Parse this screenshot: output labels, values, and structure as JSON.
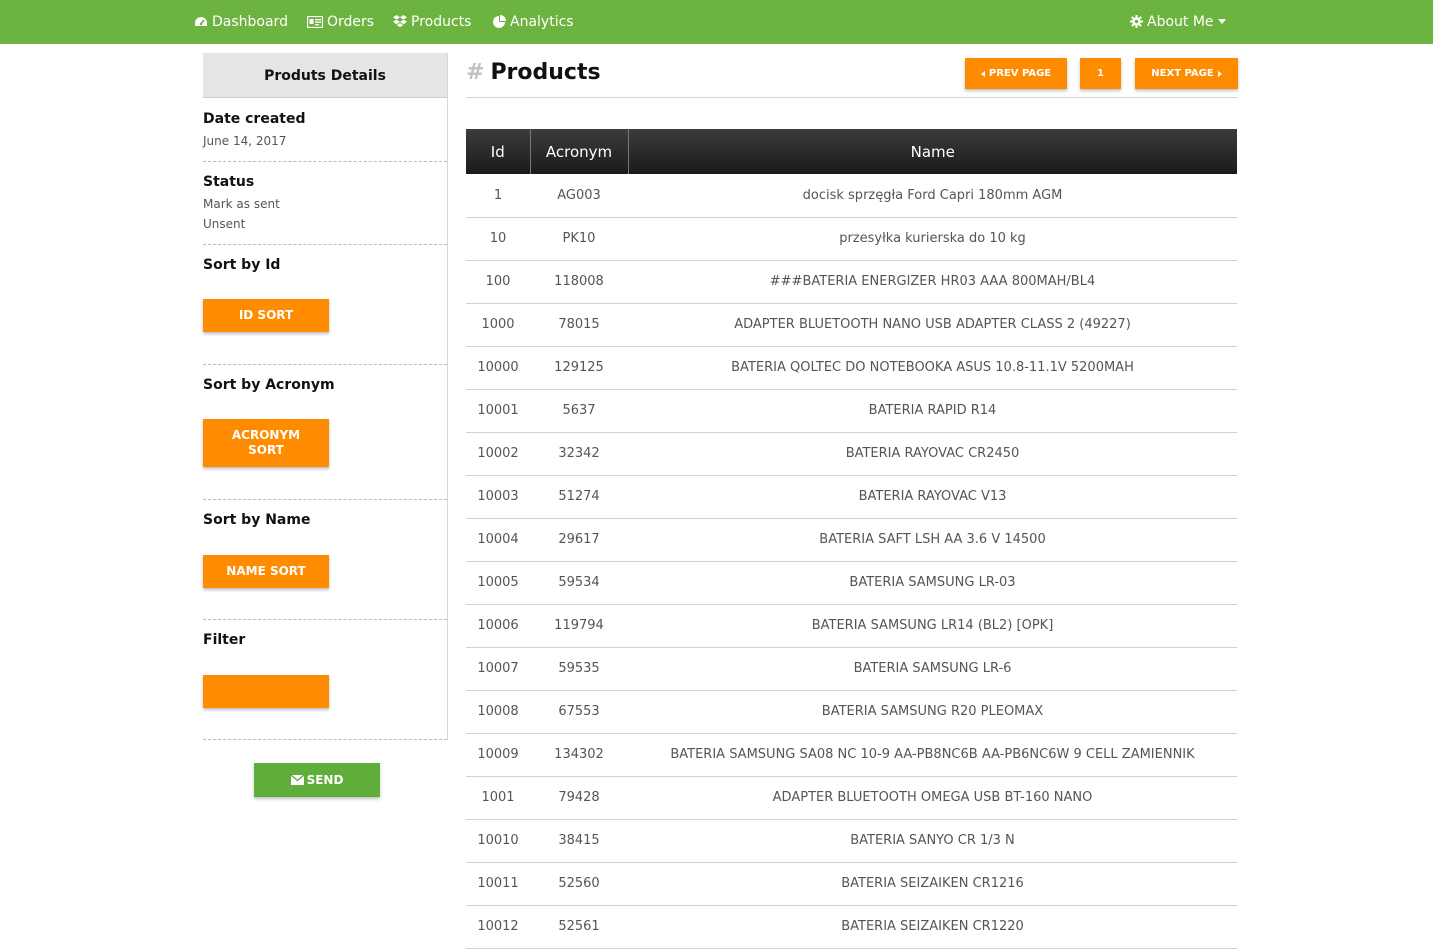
{
  "nav": {
    "dashboard": "Dashboard",
    "orders": "Orders",
    "products": "Products",
    "analytics": "Analytics",
    "about": "About Me"
  },
  "sidebar": {
    "header": "Produts Details",
    "date_title": "Date created",
    "date_value": "June 14, 2017",
    "status_title": "Status",
    "status_option_1": "Mark as sent",
    "status_option_2": "Unsent",
    "sort_id_title": "Sort by Id",
    "sort_id_button": "ID SORT",
    "sort_acronym_title": "Sort by Acronym",
    "sort_acronym_button_line1": "ACRONYM",
    "sort_acronym_button_line2": "SORT",
    "sort_name_title": "Sort by Name",
    "sort_name_button": "NAME SORT",
    "filter_title": "Filter",
    "filter_value": "",
    "send_button": "SEND"
  },
  "main": {
    "title": "Products",
    "prev_page": "PREV PAGE",
    "page_number": "1",
    "next_page": "NEXT PAGE"
  },
  "table": {
    "headers": [
      "Id",
      "Acronym",
      "Name"
    ],
    "rows": [
      [
        "1",
        "AG003",
        "docisk sprzęgła Ford Capri 180mm AGM"
      ],
      [
        "10",
        "PK10",
        "przesyłka kurierska do 10 kg"
      ],
      [
        "100",
        "118008",
        "###BATERIA ENERGIZER HR03 AAA 800MAH/BL4"
      ],
      [
        "1000",
        "78015",
        "ADAPTER BLUETOOTH NANO USB ADAPTER CLASS 2 (49227)"
      ],
      [
        "10000",
        "129125",
        "BATERIA QOLTEC DO NOTEBOOKA ASUS 10.8-11.1V 5200MAH"
      ],
      [
        "10001",
        "5637",
        "BATERIA RAPID R14"
      ],
      [
        "10002",
        "32342",
        "BATERIA RAYOVAC CR2450"
      ],
      [
        "10003",
        "51274",
        "BATERIA RAYOVAC V13"
      ],
      [
        "10004",
        "29617",
        "BATERIA SAFT LSH AA 3.6 V 14500"
      ],
      [
        "10005",
        "59534",
        "BATERIA SAMSUNG LR-03"
      ],
      [
        "10006",
        "119794",
        "BATERIA SAMSUNG LR14 (BL2) [OPK]"
      ],
      [
        "10007",
        "59535",
        "BATERIA SAMSUNG LR-6"
      ],
      [
        "10008",
        "67553",
        "BATERIA SAMSUNG R20 PLEOMAX"
      ],
      [
        "10009",
        "134302",
        "BATERIA SAMSUNG SA08 NC 10-9 AA-PB8NC6B AA-PB6NC6W 9 CELL ZAMIENNIK"
      ],
      [
        "1001",
        "79428",
        "ADAPTER BLUETOOTH OMEGA USB BT-160 NANO"
      ],
      [
        "10010",
        "38415",
        "BATERIA SANYO CR 1/3 N"
      ],
      [
        "10011",
        "52560",
        "BATERIA SEIZAIKEN CR1216"
      ],
      [
        "10012",
        "52561",
        "BATERIA SEIZAIKEN CR1220"
      ]
    ]
  },
  "colors": {
    "navbar": "#6db33f",
    "accent_orange": "#ff8c00",
    "send_green": "#5fae3b"
  },
  "icons": {
    "dashboard": "tachometer-icon",
    "orders": "id-card-icon",
    "products": "dropbox-icon",
    "analytics": "pie-chart-icon",
    "about": "gear-icon",
    "send": "envelope-icon"
  }
}
